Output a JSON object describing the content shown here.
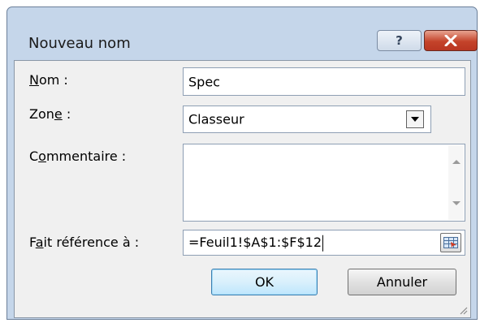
{
  "window": {
    "title": "Nouveau nom",
    "help_label": "?",
    "close_icon": "close-icon"
  },
  "form": {
    "name": {
      "label_pre": "",
      "label_key": "N",
      "label_post": "om :",
      "value": "Spec"
    },
    "scope": {
      "label_pre": "Zon",
      "label_key": "e",
      "label_post": " :",
      "value": "Classeur"
    },
    "comment": {
      "label_pre": "C",
      "label_key": "o",
      "label_post": "mmentaire :",
      "value": ""
    },
    "refers_to": {
      "label_pre": "F",
      "label_key": "a",
      "label_post": "it référence à :",
      "value": "=Feuil1!$A$1:$F$12"
    }
  },
  "buttons": {
    "ok": "OK",
    "cancel": "Annuler"
  },
  "colors": {
    "frame": "#c5d6ea",
    "close": "#c4432a",
    "default_button_border": "#3c7fb1"
  }
}
